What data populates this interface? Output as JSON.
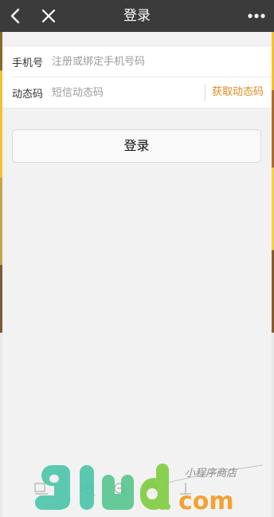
{
  "header": {
    "title": "登录",
    "back_icon": "back-arrow-icon",
    "close_icon": "close-icon",
    "more_icon": "more-dots-icon"
  },
  "form": {
    "phone_label": "手机号",
    "phone_placeholder": "注册或绑定手机号码",
    "code_label": "动态码",
    "code_placeholder": "短信动态码",
    "get_code_label": "获取动态码"
  },
  "login_button_label": "登录",
  "watermark": {
    "logo_text": "9lud.com",
    "tagline": "小程序商店"
  },
  "colors": {
    "topbar_bg": "#3b3b3b",
    "accent": "#e0891e",
    "page_bg": "#f2f2f2"
  }
}
